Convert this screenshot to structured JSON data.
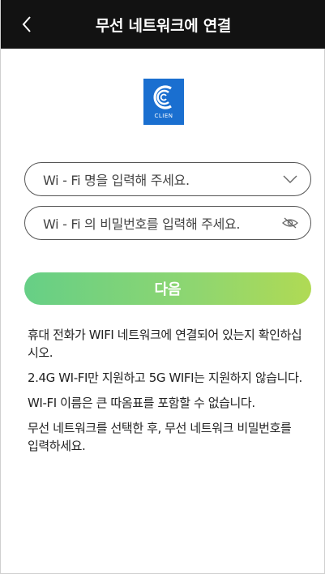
{
  "header": {
    "title": "무선 네트워크에 연결",
    "back_icon": "chevron-left-icon"
  },
  "logo": {
    "text": "CLIEN",
    "color": "#1a6fd0"
  },
  "form": {
    "ssid_placeholder": "Wi - Fi 명을 입력해 주세요.",
    "ssid_icon": "chevron-down-icon",
    "password_placeholder": "Wi - Fi 의 비밀번호를 입력해 주세요.",
    "password_icon": "eye-off-icon",
    "next_label": "다음"
  },
  "notes": [
    "휴대 전화가 WIFI 네트워크에 연결되어 있는지 확인하십시오.",
    "2.4G WI-FI만 지원하고 5G WIFI는 지원하지 않습니다.",
    "WI-FI 이름은 큰 따옴표를 포함할 수 없습니다.",
    "무선 네트워크를 선택한 후, 무선 네트워크 비밀번호를 입력하세요."
  ],
  "colors": {
    "header_bg": "#121212",
    "button_gradient_start": "#66cf86",
    "button_gradient_end": "#b0da54"
  }
}
